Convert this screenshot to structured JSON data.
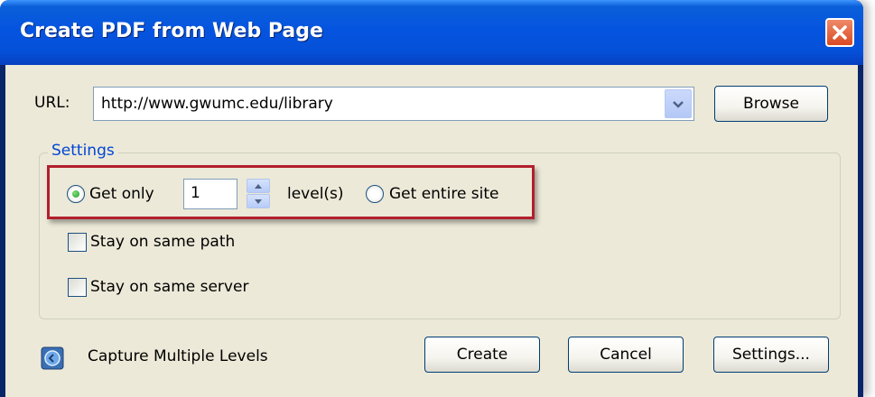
{
  "window": {
    "title": "Create PDF from Web Page"
  },
  "url": {
    "label": "URL:",
    "value": "http://www.gwumc.edu/library",
    "browse_label": "Browse"
  },
  "settings": {
    "legend": "Settings",
    "get_only_label": "Get only",
    "levels_value": "1",
    "levels_unit": "level(s)",
    "get_entire_site_label": "Get entire site",
    "get_only_selected": true,
    "stay_same_path_label": "Stay on same path",
    "stay_same_server_label": "Stay on same server"
  },
  "footer": {
    "capture_label": "Capture Multiple Levels",
    "create_label": "Create",
    "cancel_label": "Cancel",
    "settings_label": "Settings..."
  },
  "colors": {
    "title_bar": "#0554e0",
    "dialog_bg": "#ece9d8",
    "legend_text": "#0046d5",
    "highlight_border": "#b21f2d"
  },
  "icons": {
    "close": "close-icon",
    "dropdown": "chevron-down-icon",
    "spin_up": "arrow-up-icon",
    "spin_down": "arrow-down-icon",
    "capture": "capture-levels-icon"
  }
}
